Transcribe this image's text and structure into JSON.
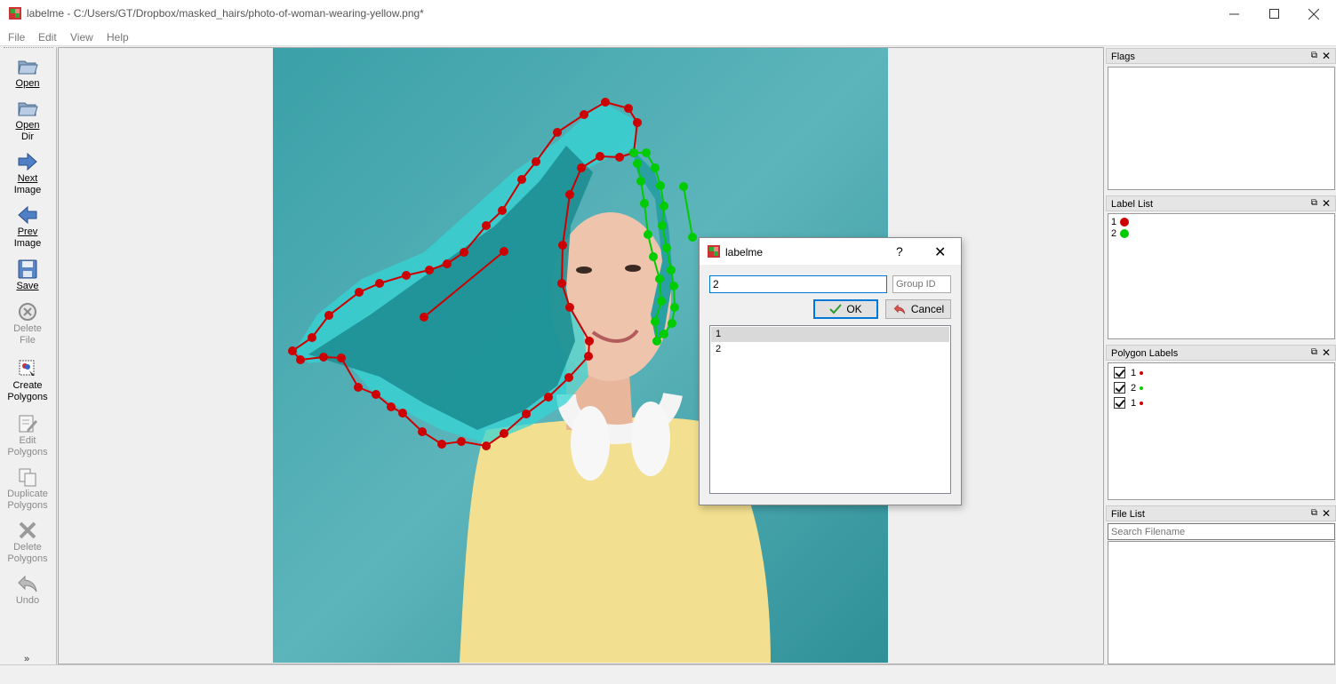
{
  "window": {
    "title": "labelme - C:/Users/GT/Dropbox/masked_hairs/photo-of-woman-wearing-yellow.png*",
    "controls": [
      "minimize-icon",
      "maximize-icon",
      "close-icon"
    ]
  },
  "menu": {
    "items": [
      "File",
      "Edit",
      "View",
      "Help"
    ]
  },
  "toolbar": {
    "open": {
      "line1": "Open",
      "icon": "folder-icon"
    },
    "open_dir": {
      "line1": "Open",
      "line2": "Dir",
      "icon": "folder-icon"
    },
    "next_image": {
      "line1": "Next",
      "line2": "Image",
      "icon": "arrow-right-icon"
    },
    "prev_image": {
      "line1": "Prev",
      "line2": "Image",
      "icon": "arrow-left-icon"
    },
    "save": {
      "line1": "Save",
      "icon": "floppy-icon"
    },
    "delete_file": {
      "line1": "Delete",
      "line2": "File",
      "icon": "delete-circle-icon"
    },
    "create_polygons": {
      "line1": "Create",
      "line2": "Polygons",
      "icon": "create-polygon-icon"
    },
    "edit_polygons": {
      "line1": "Edit",
      "line2": "Polygons",
      "icon": "edit-icon"
    },
    "duplicate_polygons": {
      "line1": "Duplicate",
      "line2": "Polygons",
      "icon": "copy-icon"
    },
    "delete_polygons": {
      "line1": "Delete",
      "line2": "Polygons",
      "icon": "cross-icon"
    },
    "undo": {
      "line1": "Undo",
      "icon": "undo-icon"
    },
    "more": "»"
  },
  "panels": {
    "flags": {
      "title": "Flags"
    },
    "label_list": {
      "title": "Label List",
      "items": [
        {
          "label": "1",
          "color": "#cc0000"
        },
        {
          "label": "2",
          "color": "#00cc00"
        }
      ]
    },
    "polygon_labels": {
      "title": "Polygon Labels",
      "items": [
        {
          "label": "1",
          "color": "#cc0000",
          "checked": true
        },
        {
          "label": "2",
          "color": "#00cc00",
          "checked": true
        },
        {
          "label": "1",
          "color": "#cc0000",
          "checked": true
        }
      ]
    },
    "file_list": {
      "title": "File List",
      "search_placeholder": "Search Filename"
    }
  },
  "dialog": {
    "title": "labelme",
    "help": "?",
    "label_value": "2",
    "group_id_placeholder": "Group ID",
    "ok_label": "OK",
    "cancel_label": "Cancel",
    "items": [
      "1",
      "2"
    ],
    "selected_index": 0
  },
  "colors": {
    "polygon_1": "#cc0000",
    "polygon_2": "#00cc00",
    "background": "#3ea3ab",
    "accent": "#0078d7"
  }
}
